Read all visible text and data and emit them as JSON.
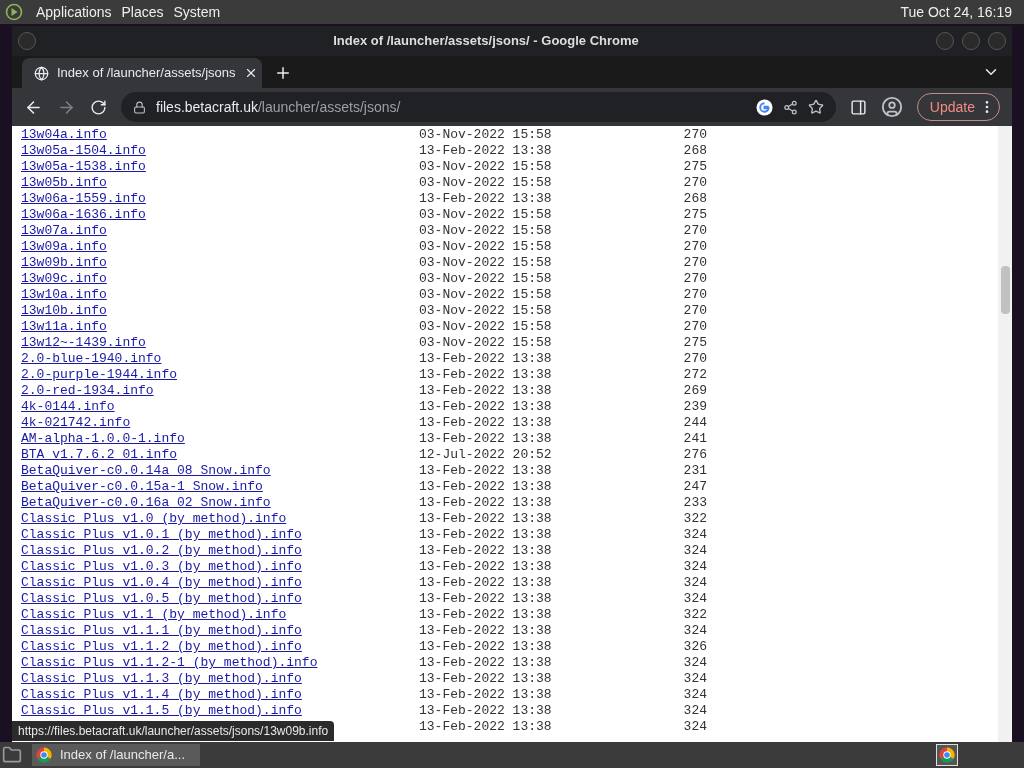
{
  "top_panel": {
    "menus": [
      "Applications",
      "Places",
      "System"
    ],
    "clock": "Tue Oct 24, 16:19"
  },
  "window": {
    "title": "Index of /launcher/assets/jsons/ - Google Chrome"
  },
  "tabs": [
    {
      "label": "Index of /launcher/assets/jsons",
      "selected": true
    }
  ],
  "address": {
    "host": "files.betacraft.uk",
    "path": "/launcher/assets/jsons/"
  },
  "update_button": "Update",
  "listing": [
    {
      "name": "13w04a.info",
      "date": "03-Nov-2022 15:58",
      "size": "270"
    },
    {
      "name": "13w05a-1504.info",
      "date": "13-Feb-2022 13:38",
      "size": "268"
    },
    {
      "name": "13w05a-1538.info",
      "date": "03-Nov-2022 15:58",
      "size": "275"
    },
    {
      "name": "13w05b.info",
      "date": "03-Nov-2022 15:58",
      "size": "270"
    },
    {
      "name": "13w06a-1559.info",
      "date": "13-Feb-2022 13:38",
      "size": "268"
    },
    {
      "name": "13w06a-1636.info",
      "date": "03-Nov-2022 15:58",
      "size": "275"
    },
    {
      "name": "13w07a.info",
      "date": "03-Nov-2022 15:58",
      "size": "270"
    },
    {
      "name": "13w09a.info",
      "date": "03-Nov-2022 15:58",
      "size": "270"
    },
    {
      "name": "13w09b.info",
      "date": "03-Nov-2022 15:58",
      "size": "270"
    },
    {
      "name": "13w09c.info",
      "date": "03-Nov-2022 15:58",
      "size": "270"
    },
    {
      "name": "13w10a.info",
      "date": "03-Nov-2022 15:58",
      "size": "270"
    },
    {
      "name": "13w10b.info",
      "date": "03-Nov-2022 15:58",
      "size": "270"
    },
    {
      "name": "13w11a.info",
      "date": "03-Nov-2022 15:58",
      "size": "270"
    },
    {
      "name": "13w12~-1439.info",
      "date": "03-Nov-2022 15:58",
      "size": "275"
    },
    {
      "name": "2.0-blue-1940.info",
      "date": "13-Feb-2022 13:38",
      "size": "270"
    },
    {
      "name": "2.0-purple-1944.info",
      "date": "13-Feb-2022 13:38",
      "size": "272"
    },
    {
      "name": "2.0-red-1934.info",
      "date": "13-Feb-2022 13:38",
      "size": "269"
    },
    {
      "name": "4k-0144.info",
      "date": "13-Feb-2022 13:38",
      "size": "239"
    },
    {
      "name": "4k-021742.info",
      "date": "13-Feb-2022 13:38",
      "size": "244"
    },
    {
      "name": "AM-alpha-1.0.0-1.info",
      "date": "13-Feb-2022 13:38",
      "size": "241"
    },
    {
      "name": "BTA v1.7.6.2 01.info",
      "date": "12-Jul-2022 20:52",
      "size": "276"
    },
    {
      "name": "BetaQuiver-c0.0.14a 08 Snow.info",
      "date": "13-Feb-2022 13:38",
      "size": "231"
    },
    {
      "name": "BetaQuiver-c0.0.15a-1 Snow.info",
      "date": "13-Feb-2022 13:38",
      "size": "247"
    },
    {
      "name": "BetaQuiver-c0.0.16a 02 Snow.info",
      "date": "13-Feb-2022 13:38",
      "size": "233"
    },
    {
      "name": "Classic Plus v1.0 (by method).info",
      "date": "13-Feb-2022 13:38",
      "size": "322"
    },
    {
      "name": "Classic Plus v1.0.1 (by method).info",
      "date": "13-Feb-2022 13:38",
      "size": "324"
    },
    {
      "name": "Classic Plus v1.0.2 (by method).info",
      "date": "13-Feb-2022 13:38",
      "size": "324"
    },
    {
      "name": "Classic Plus v1.0.3 (by method).info",
      "date": "13-Feb-2022 13:38",
      "size": "324"
    },
    {
      "name": "Classic Plus v1.0.4 (by method).info",
      "date": "13-Feb-2022 13:38",
      "size": "324"
    },
    {
      "name": "Classic Plus v1.0.5 (by method).info",
      "date": "13-Feb-2022 13:38",
      "size": "324"
    },
    {
      "name": "Classic Plus v1.1 (by method).info",
      "date": "13-Feb-2022 13:38",
      "size": "322"
    },
    {
      "name": "Classic Plus v1.1.1 (by method).info",
      "date": "13-Feb-2022 13:38",
      "size": "324"
    },
    {
      "name": "Classic Plus v1.1.2 (by method).info",
      "date": "13-Feb-2022 13:38",
      "size": "326"
    },
    {
      "name": "Classic Plus v1.1.2-1 (by method).info",
      "date": "13-Feb-2022 13:38",
      "size": "324"
    },
    {
      "name": "Classic Plus v1.1.3 (by method).info",
      "date": "13-Feb-2022 13:38",
      "size": "324"
    },
    {
      "name": "Classic Plus v1.1.4 (by method).info",
      "date": "13-Feb-2022 13:38",
      "size": "324"
    },
    {
      "name": "Classic Plus v1.1.5 (by method).info",
      "date": "13-Feb-2022 13:38",
      "size": "324"
    },
    {
      "date": "13-Feb-2022 13:38",
      "size": "324"
    }
  ],
  "status_url": "https://files.betacraft.uk/launcher/assets/jsons/13w09b.info",
  "taskbar": {
    "tasks": [
      "Index of /launcher/a..."
    ]
  }
}
